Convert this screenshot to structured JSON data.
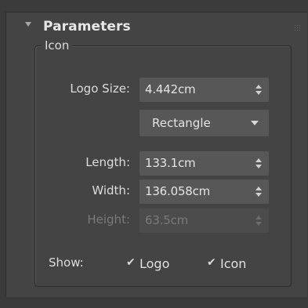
{
  "rollout": {
    "title": "Parameters",
    "collapse_icon": "collapse-arrow-icon",
    "grip_icon": "grip-icon"
  },
  "group": {
    "label": "Icon"
  },
  "fields": {
    "logo_size": {
      "label": "Logo Size:",
      "value": "4.442cm"
    },
    "shape": {
      "value": "Rectangle"
    },
    "length": {
      "label": "Length:",
      "value": "133.1cm"
    },
    "width": {
      "label": "Width:",
      "value": "136.058cm"
    },
    "height": {
      "label": "Height:",
      "value": "63.5cm",
      "enabled": false
    }
  },
  "show": {
    "label": "Show:",
    "logo": {
      "label": "Logo",
      "checked": true
    },
    "icon": {
      "label": "Icon",
      "checked": true
    }
  },
  "colors": {
    "panel_bg": "#444444",
    "field_bg": "#575757",
    "text": "#dcdcdc",
    "disabled_text": "#7a7a7a"
  }
}
